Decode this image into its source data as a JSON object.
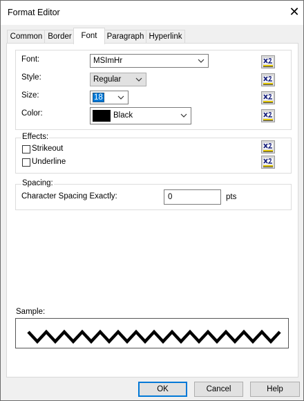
{
  "window": {
    "title": "Format Editor",
    "close_glyph": "✕"
  },
  "tabs": [
    {
      "label": "Common"
    },
    {
      "label": "Border"
    },
    {
      "label": "Font",
      "active": true
    },
    {
      "label": "Paragraph"
    },
    {
      "label": "Hyperlink"
    }
  ],
  "font_group": {
    "font_label": "Font:",
    "font_value": "MSImHr",
    "style_label": "Style:",
    "style_value": "Regular",
    "size_label": "Size:",
    "size_value": "18",
    "color_label": "Color:",
    "color_value": "Black",
    "color_swatch": "#000000"
  },
  "effects": {
    "title": "Effects:",
    "strikeout_label": "Strikeout",
    "strikeout_checked": false,
    "underline_label": "Underline",
    "underline_checked": false
  },
  "spacing": {
    "title": "Spacing:",
    "char_spacing_label": "Character Spacing Exactly:",
    "char_spacing_value": "0",
    "unit": "pts"
  },
  "sample": {
    "label": "Sample:"
  },
  "formula_button_icon": "formula-icon",
  "buttons": {
    "ok": "OK",
    "cancel": "Cancel",
    "help": "Help"
  },
  "colors": {
    "accent": "#0078d7",
    "selection": "#0078d7"
  }
}
